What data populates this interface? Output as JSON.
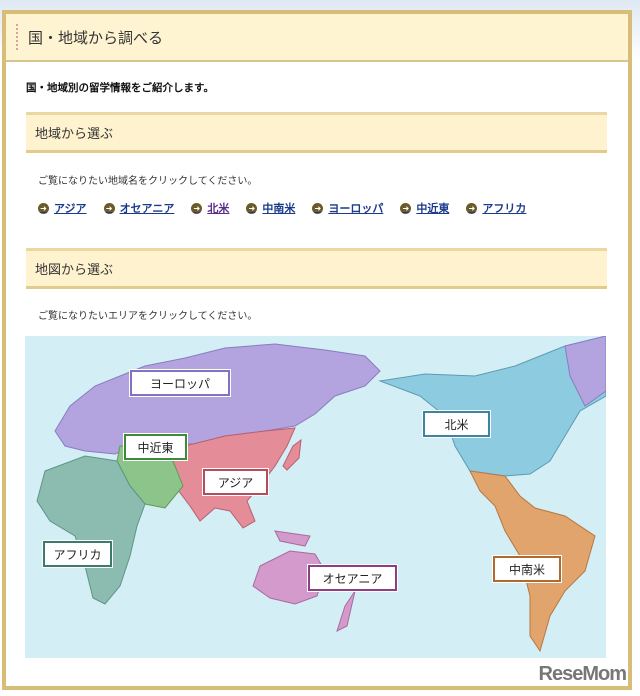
{
  "header": {
    "title": "国・地域から調べる"
  },
  "intro": "国・地域別の留学情報をご紹介します。",
  "region_section": {
    "title": "地域から選ぶ",
    "instruction": "ご覧になりたい地域名をクリックしてください。",
    "links": [
      {
        "label": "アジア"
      },
      {
        "label": "オセアニア"
      },
      {
        "label": "北米",
        "visited": true
      },
      {
        "label": "中南米"
      },
      {
        "label": "ヨーロッパ"
      },
      {
        "label": "中近東"
      },
      {
        "label": "アフリカ"
      }
    ]
  },
  "map_section": {
    "title": "地図から選ぶ",
    "instruction": "ご覧になりたいエリアをクリックしてください。",
    "labels": {
      "europe": "ヨーロッパ",
      "middle_east": "中近東",
      "asia": "アジア",
      "africa": "アフリカ",
      "oceania": "オセアニア",
      "north_america": "北米",
      "latin_america": "中南米"
    },
    "colors": {
      "europe": "#b3a3df",
      "middle_east": "#8cc48a",
      "asia": "#e48c98",
      "africa": "#8cbcb0",
      "oceania": "#d49acb",
      "north_america": "#8ccbe0",
      "latin_america": "#e0a46c",
      "ocean": "#d4eef5"
    }
  },
  "watermark": "ReseMom"
}
